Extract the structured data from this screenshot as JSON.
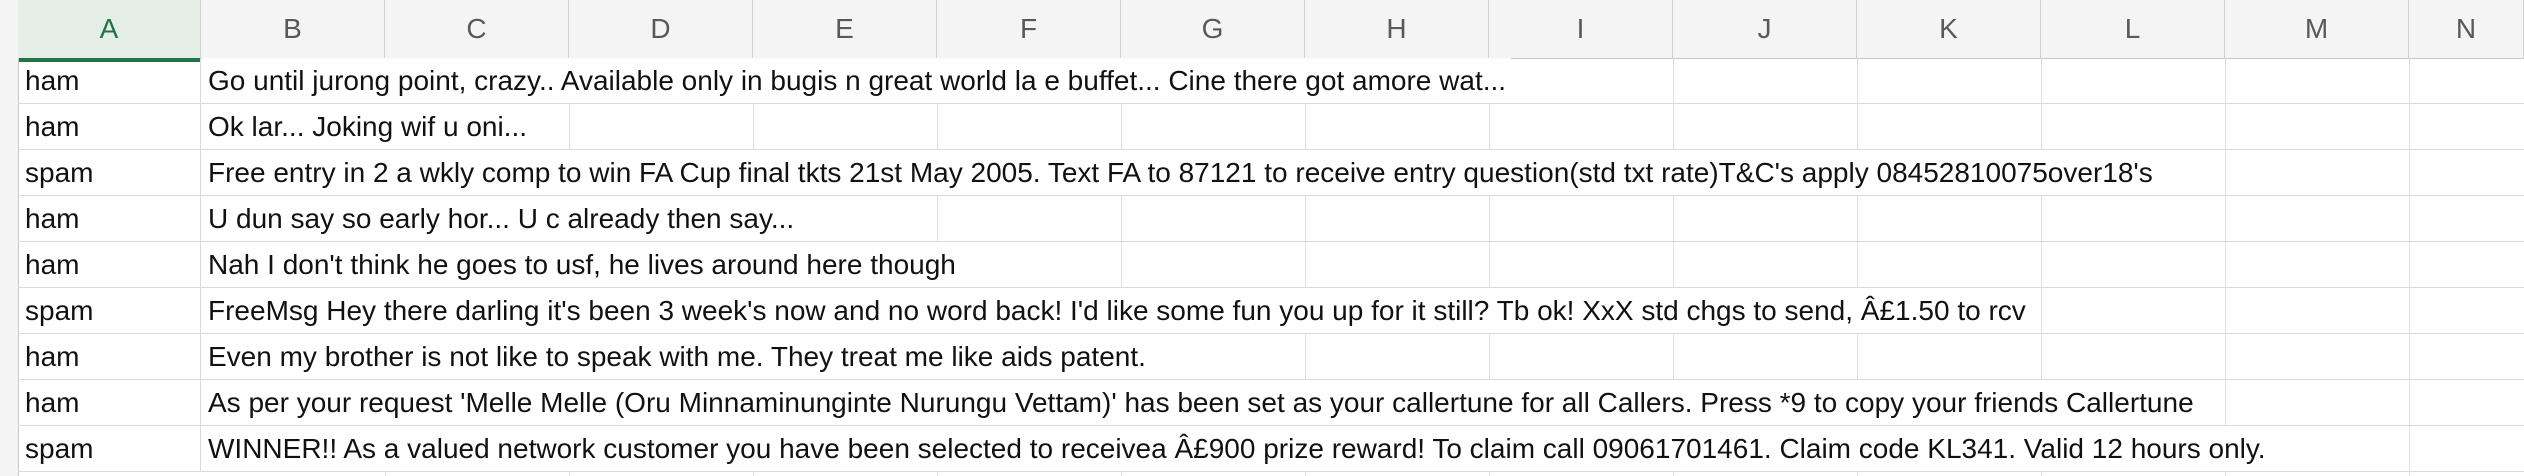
{
  "columns": [
    "A",
    "B",
    "C",
    "D",
    "E",
    "F",
    "G",
    "H",
    "I",
    "J",
    "K",
    "L",
    "M",
    "N"
  ],
  "selected_column": "A",
  "rows": [
    {
      "label": "ham",
      "message": "Go until jurong point, crazy.. Available only in bugis n great world la e buffet... Cine there got amore wat..."
    },
    {
      "label": "ham",
      "message": "Ok lar... Joking wif u oni..."
    },
    {
      "label": "spam",
      "message": "Free entry in 2 a wkly comp to win FA Cup final tkts 21st May 2005. Text FA to 87121 to receive entry question(std txt rate)T&C's apply 08452810075over18's"
    },
    {
      "label": "ham",
      "message": "U dun say so early hor... U c already then say..."
    },
    {
      "label": "ham",
      "message": "Nah I don't think he goes to usf, he lives around here though"
    },
    {
      "label": "spam",
      "message": "FreeMsg Hey there darling it's been 3 week's now and no word back! I'd like some fun you up for it still? Tb ok! XxX std chgs to send, Â£1.50 to rcv"
    },
    {
      "label": "ham",
      "message": "Even my brother is not like to speak with me. They treat me like aids patent."
    },
    {
      "label": "ham",
      "message": "As per your request 'Melle Melle (Oru Minnaminunginte Nurungu Vettam)' has been set as your callertune for all Callers. Press *9 to copy your friends Callertune"
    },
    {
      "label": "spam",
      "message": "WINNER!! As a valued network customer you have been selected to receivea Â£900 prize reward! To claim call 09061701461. Claim code KL341. Valid 12 hours only."
    }
  ],
  "colors": {
    "header_bg": "#f4f4f4",
    "selected_header_bg": "#e2eee6",
    "selected_accent": "#217346",
    "grid_line": "#dadada",
    "text": "#111111"
  }
}
